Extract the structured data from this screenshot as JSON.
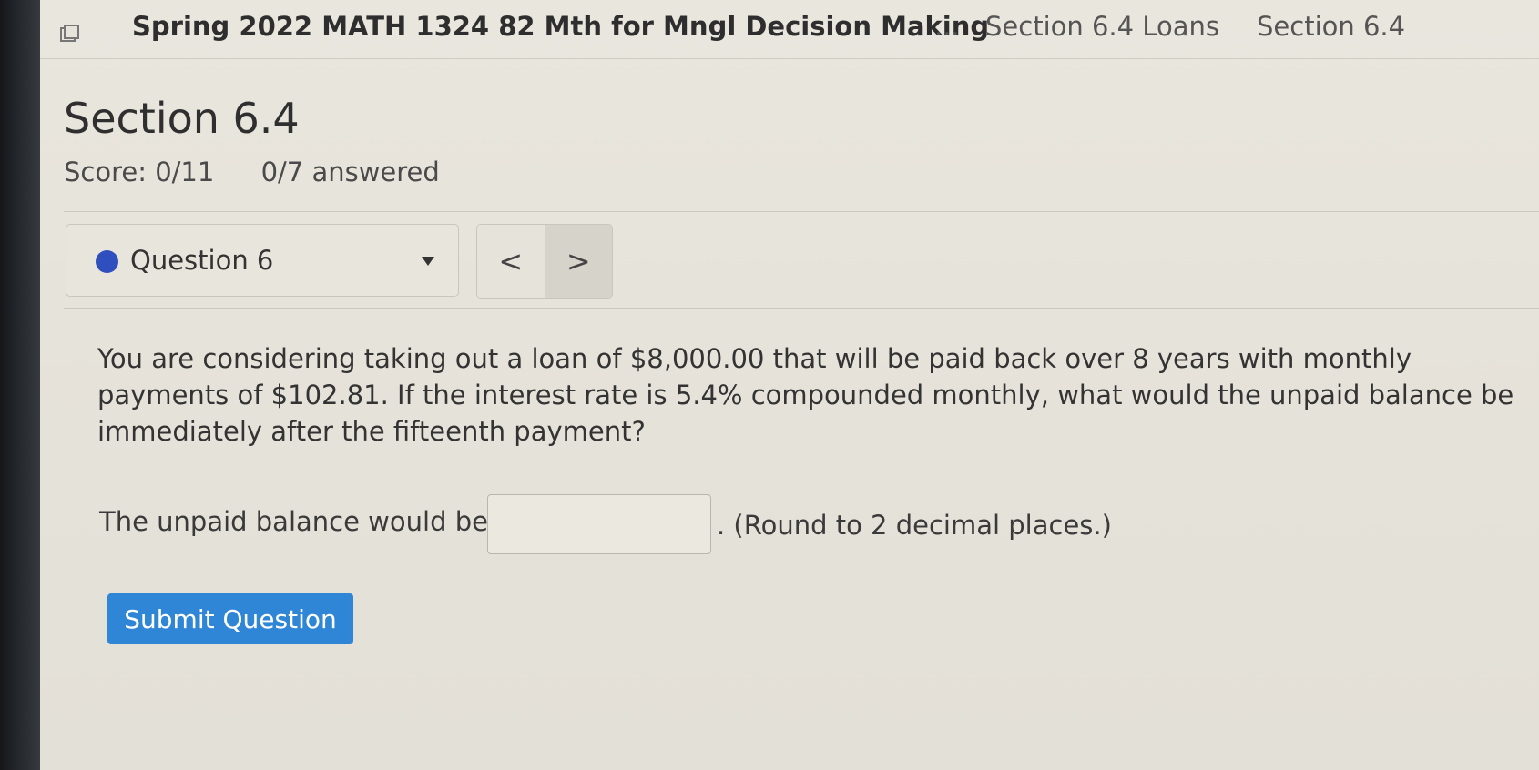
{
  "breadcrumb": {
    "course": "Spring 2022 MATH 1324 82 Mth for Mngl Decision Making",
    "ellipsis": "...",
    "assignment": "Section 6.4 Loans",
    "current": "Section 6.4"
  },
  "assignment": {
    "title": "Section 6.4",
    "score": "Score: 0/11",
    "answered": "0/7 answered"
  },
  "question_nav": {
    "selected": "Question 6",
    "status_color": "#2f4fbf",
    "prev_label": "<",
    "next_label": ">"
  },
  "question": {
    "text": "You are considering taking out a loan of $8,000.00 that will be paid back over 8 years with monthly payments of $102.81. If the interest rate is 5.4% compounded monthly, what would the unpaid balance be immediately after the fifteenth payment?",
    "answer_prefix": "The unpaid balance would be $",
    "answer_value": "",
    "answer_suffix": ". (Round to 2 decimal places.)",
    "submit_label": "Submit Question"
  },
  "colors": {
    "submit": "#2f86d6",
    "background": "#e7e4dc"
  }
}
